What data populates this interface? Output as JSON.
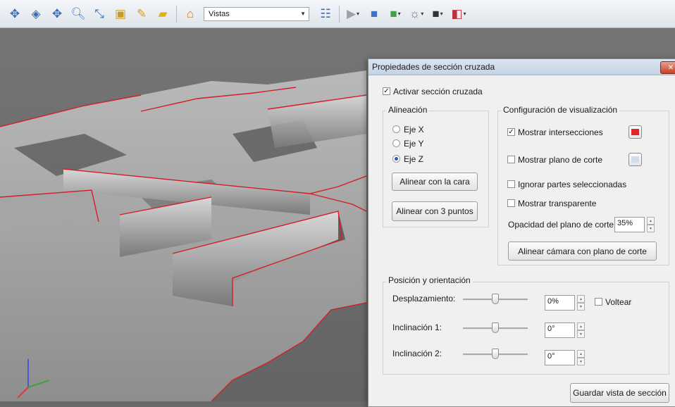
{
  "toolbar": {
    "icons": [
      "navigate-icon",
      "orbit-icon",
      "pan-icon",
      "zoom-icon",
      "select-arrow-icon",
      "camera-icon",
      "measure-icon",
      "annotation-icon",
      "home-icon"
    ],
    "views_value": "Vistas",
    "right_icons": [
      "tree-icon",
      "play-icon",
      "cube-icon",
      "cubes-icon",
      "light-icon",
      "color-square-icon",
      "section-icon"
    ]
  },
  "dialog": {
    "title": "Propiedades de sección cruzada",
    "enable_section": {
      "label": "Activar sección cruzada",
      "checked": true
    },
    "alignment": {
      "title": "Alineación",
      "axes": [
        {
          "label": "Eje X",
          "selected": false
        },
        {
          "label": "Eje Y",
          "selected": false
        },
        {
          "label": "Eje Z",
          "selected": true
        }
      ],
      "align_face_button": "Alinear con la cara",
      "align_3pts_button": "Alinear con 3 puntos"
    },
    "display": {
      "title": "Configuración de visualización",
      "show_intersections": {
        "label": "Mostrar intersecciones",
        "checked": true,
        "color": "#e0262a"
      },
      "show_plane": {
        "label": "Mostrar plano de corte",
        "checked": false,
        "color": "#cfdcea"
      },
      "ignore_selected": {
        "label": "Ignorar partes seleccionadas",
        "checked": false
      },
      "show_transparent": {
        "label": "Mostrar transparente",
        "checked": false
      },
      "opacity_label": "Opacidad del plano de corte:",
      "opacity_value": "35%",
      "align_camera_button": "Alinear cámara con plano de corte"
    },
    "position": {
      "title": "Posición y orientación",
      "rows": [
        {
          "label": "Desplazamiento:",
          "value": "0%",
          "slider": 0.5
        },
        {
          "label": "Inclinación 1:",
          "value": "0°",
          "slider": 0.5
        },
        {
          "label": "Inclinación 2:",
          "value": "0°",
          "slider": 0.5
        }
      ],
      "flip_label": "Voltear",
      "flip_checked": false
    },
    "save_button": "Guardar vista de sección"
  }
}
